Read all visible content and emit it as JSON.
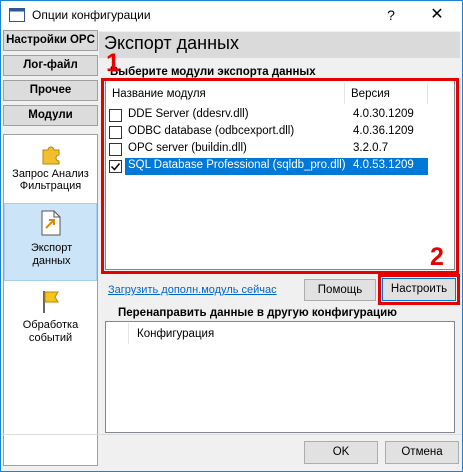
{
  "window": {
    "title": "Опции конфигурации",
    "help_button": "?",
    "close_button": "✕"
  },
  "nav": {
    "tabs": [
      "Настройки OPC",
      "Лог-файл",
      "Прочее",
      "Модули"
    ],
    "items": [
      {
        "line1": "Запрос Анализ",
        "line2": "Фильтрация",
        "icon": "puzzle-icon"
      },
      {
        "line1": "Экспорт",
        "line2": "данных",
        "icon": "export-document-icon"
      },
      {
        "line1": "Обработка",
        "line2": "событий",
        "icon": "flag-icon"
      }
    ]
  },
  "main": {
    "heading": "Экспорт данных",
    "modules_label": "Выберите модули экспорта данных",
    "columns": {
      "name": "Название модуля",
      "version": "Версия"
    },
    "modules": [
      {
        "name": "DDE Server (ddesrv.dll)",
        "version": "4.0.30.1209",
        "checked": false
      },
      {
        "name": "ODBC database (odbcexport.dll)",
        "version": "4.0.36.1209",
        "checked": false
      },
      {
        "name": "OPC server (buildin.dll)",
        "version": "3.2.0.7",
        "checked": false
      },
      {
        "name": "SQL Database Professional (sqldb_pro.dll)",
        "version": "4.0.53.1209",
        "checked": true
      }
    ],
    "annotation_1": "1",
    "annotation_2": "2",
    "load_link": "Загрузить дополн.модуль сейчас",
    "help_button": "Помощь",
    "configure_button": "Настроить",
    "redirect_label": "Перенаправить данные в другую конфигурацию",
    "config_column": "Конфигурация"
  },
  "footer": {
    "ok_button": "OK",
    "cancel_button": "Отмена"
  },
  "colors": {
    "accent": "#0078d7",
    "annotation": "#e60000",
    "selection": "#cce4f7"
  }
}
